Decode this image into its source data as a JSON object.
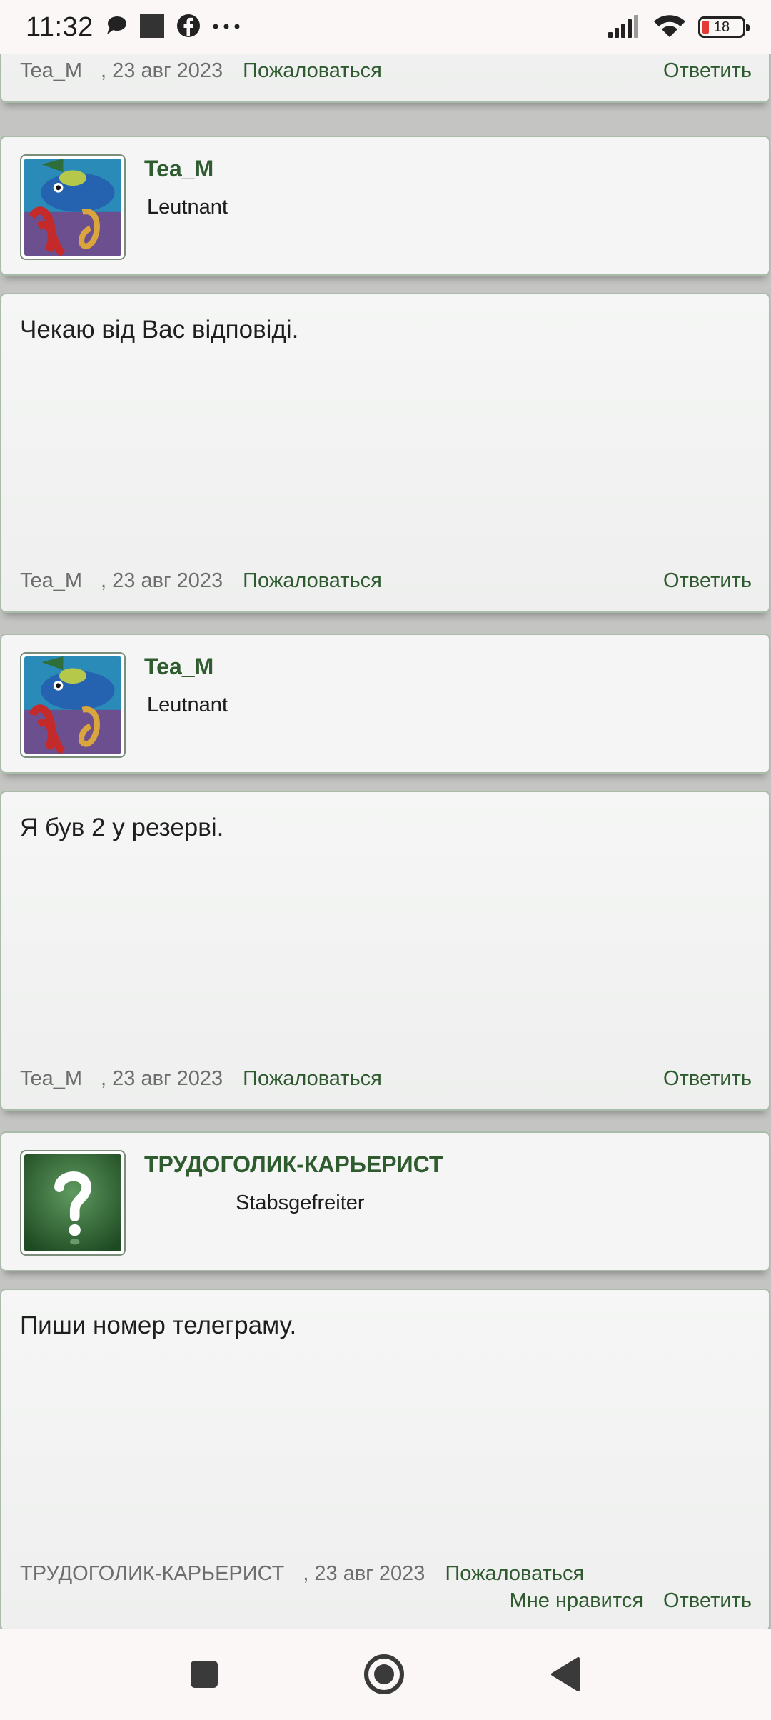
{
  "status_bar": {
    "time": "11:32",
    "battery": "18",
    "icons": [
      "chat-bubble-icon",
      "square-icon",
      "facebook-icon",
      "more-dots-icon",
      "signal-icon",
      "wifi-icon",
      "battery-icon"
    ]
  },
  "labels": {
    "complain": "Пожаловаться",
    "reply": "Ответить",
    "like": "Мне нравится"
  },
  "colors": {
    "accent_green": "#2e5c2e",
    "card_border": "#a9bca9",
    "battery_low": "#e53935"
  },
  "top_partial_footer": {
    "author": "Tea_M",
    "date": ", 23 авг 2023"
  },
  "posts": [
    {
      "author": "Tea_M",
      "rank": "Leutnant",
      "avatar": "octopus-avatar",
      "text": "Чекаю від Вас відповіді.",
      "footer_author": "Tea_M",
      "date": ", 23 авг 2023"
    },
    {
      "author": "Tea_M",
      "rank": "Leutnant",
      "avatar": "octopus-avatar",
      "text": "Я був 2 у резерві.",
      "footer_author": "Tea_M",
      "date": ", 23 авг 2023"
    },
    {
      "author": "ТРУДОГОЛИК-КАРЬЕРИСТ",
      "rank": "Stabsgefreiter",
      "avatar": "question-mark-avatar",
      "text": "Пиши номер телеграму.",
      "footer_author": "ТРУДОГОЛИК-КАРЬЕРИСТ",
      "date": ", 23 авг 2023"
    }
  ],
  "nav_bar": {
    "buttons": [
      "recents-square-icon",
      "home-circle-icon",
      "back-triangle-icon"
    ]
  }
}
